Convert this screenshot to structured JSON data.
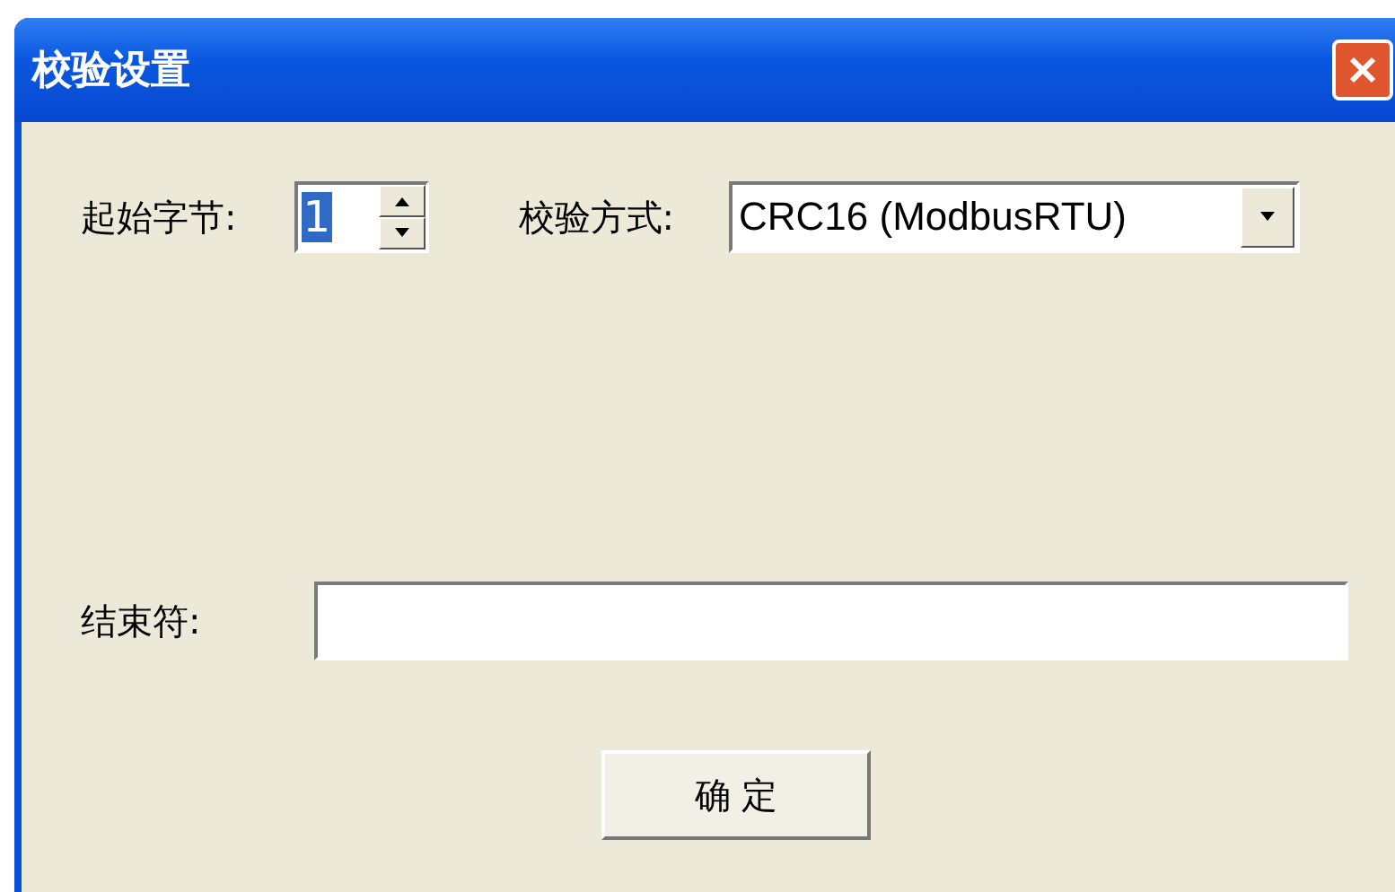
{
  "window": {
    "title": "校验设置"
  },
  "start_byte": {
    "label": "起始字节:",
    "value": "1",
    "value_selected": true
  },
  "check_method": {
    "label": "校验方式:",
    "value": "CRC16 (ModbusRTU)"
  },
  "terminator": {
    "label": "结束符:"
  },
  "buttons": [
    {
      "label": "确 定"
    }
  ]
}
